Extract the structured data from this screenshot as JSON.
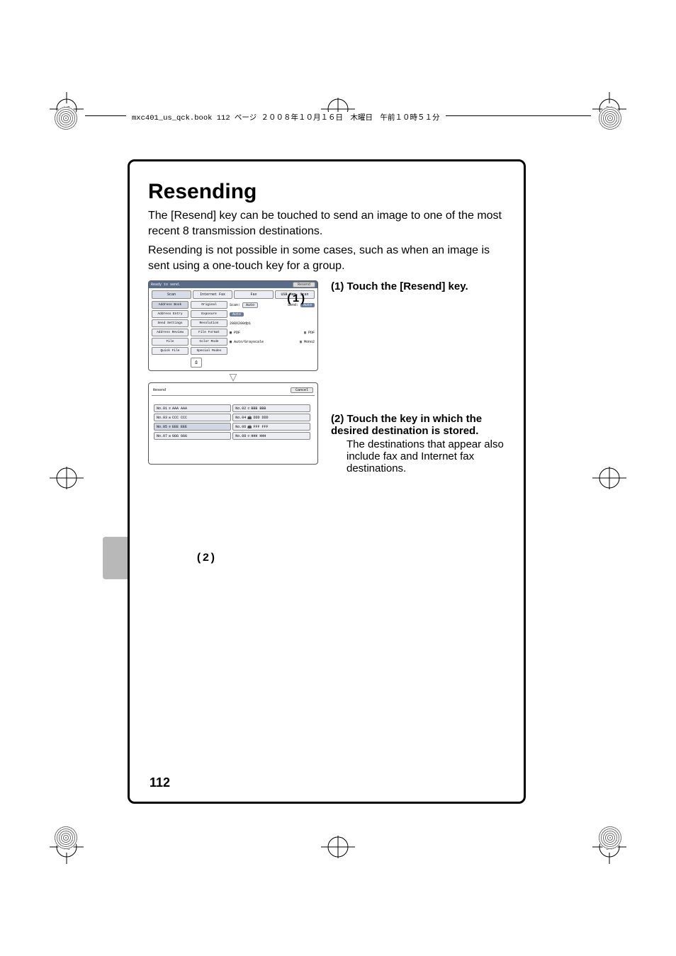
{
  "header": "mxc401_us_qck.book  112 ページ  ２００８年１０月１６日　木曜日　午前１０時５１分",
  "title": "Resending",
  "intro_p1": "The [Resend] key can be touched to send an image to one of the most recent 8 transmission destinations.",
  "intro_p2": "Resending is not possible in some cases, such as when an image is sent using a one-touch key for a group.",
  "step1": "(1) Touch the [Resend] key.",
  "step2": "(2) Touch the key in which the desired destination is stored.",
  "step2_sub": "The destinations that appear also include fax and Internet fax destinations.",
  "page_number": "112",
  "callout1": "(1)",
  "callout2": "(2)",
  "panel1": {
    "status": "Ready to send.",
    "resend_btn": "Resend",
    "tabs": [
      "Scan",
      "Internet Fax",
      "Fax",
      "USB Mem. Scan"
    ],
    "side": [
      "Address Book",
      "Address Entry",
      "Send Settings",
      "Address Review",
      "File",
      "Quick File"
    ],
    "rows": {
      "original": "Original",
      "scan_label": "Scan:",
      "scan_value": "Auto",
      "send_label": "Send:",
      "send_value": "Auto",
      "exposure": "Exposure",
      "exposure_val": "Auto",
      "resolution": "Resolution",
      "resolution_val": "200X200dpi",
      "file_format": "File Format",
      "ff_v1": "PDF",
      "ff_v2": "PDF",
      "color_mode": "Color Mode",
      "cm_v1": "Auto/Grayscale",
      "cm_v2": "Mono2",
      "special": "Special Modes"
    }
  },
  "panel2": {
    "title": "Resend",
    "cancel": "Cancel",
    "dests": [
      {
        "no": "No.01",
        "name": "AAA AAA",
        "type": "phone"
      },
      {
        "no": "No.02",
        "name": "BBB BBB",
        "type": "phone"
      },
      {
        "no": "No.03",
        "name": "CCC CCC",
        "type": "mail"
      },
      {
        "no": "No.04",
        "name": "DDD DDD",
        "type": "fax"
      },
      {
        "no": "No.05",
        "name": "EEE EEE",
        "type": "phone",
        "sel": true
      },
      {
        "no": "No.06",
        "name": "FFF FFF",
        "type": "fax"
      },
      {
        "no": "No.07",
        "name": "GGG GGG",
        "type": "mail"
      },
      {
        "no": "No.08",
        "name": "HHH HHH",
        "type": "phone"
      }
    ]
  }
}
